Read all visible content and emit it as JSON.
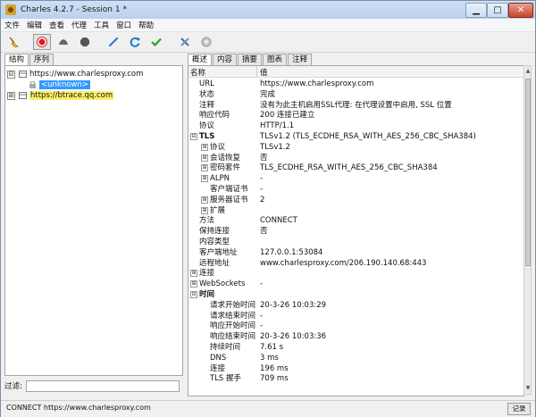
{
  "window": {
    "title": "Charles 4.2.7 - Session 1 *"
  },
  "menu": [
    "文件",
    "编辑",
    "查看",
    "代理",
    "工具",
    "窗口",
    "帮助"
  ],
  "toolbar": [
    "broom-icon",
    "record-icon",
    "throttle-icon",
    "breakpoint-icon",
    "compose-icon",
    "repeat-icon",
    "validate-icon",
    "tools-icon",
    "settings-icon"
  ],
  "left": {
    "tabs": [
      "结构",
      "序列"
    ],
    "tree": [
      {
        "label": "https://www.charlesproxy.com",
        "expander": "⊟",
        "level": 0
      },
      {
        "label": "<unknown>",
        "expander": "",
        "level": 1
      },
      {
        "label": "https://btrace.qq.com",
        "expander": "⊞",
        "level": 0
      }
    ],
    "filter_label": "过滤:",
    "filter_value": ""
  },
  "right": {
    "tabs": [
      "概述",
      "内容",
      "摘要",
      "图表",
      "注释"
    ],
    "header": {
      "name": "名称",
      "value": "值"
    },
    "rows": [
      {
        "name": "URL",
        "value": "https://www.charlesproxy.com",
        "level": 1
      },
      {
        "name": "状态",
        "value": "完成",
        "level": 1
      },
      {
        "name": "注释",
        "value": "没有为此主机启用SSL代理: 在代理设置中启用, SSL 位置",
        "level": 1
      },
      {
        "name": "响应代码",
        "value": "200 连接已建立",
        "level": 1
      },
      {
        "name": "协议",
        "value": "HTTP/1.1",
        "level": 1
      },
      {
        "name": "TLS",
        "value": "TLSv1.2 (TLS_ECDHE_RSA_WITH_AES_256_CBC_SHA384)",
        "level": 0,
        "expander": "⊟",
        "bold": true
      },
      {
        "name": "协议",
        "value": "TLSv1.2",
        "level": 2,
        "expander": "⊞"
      },
      {
        "name": "会话恢复",
        "value": "否",
        "level": 2,
        "expander": "⊞"
      },
      {
        "name": "密码套件",
        "value": "TLS_ECDHE_RSA_WITH_AES_256_CBC_SHA384",
        "level": 2,
        "expander": "⊞"
      },
      {
        "name": "ALPN",
        "value": "-",
        "level": 2,
        "expander": "⊞"
      },
      {
        "name": "客户端证书",
        "value": "-",
        "level": 2
      },
      {
        "name": "服务器证书",
        "value": "2",
        "level": 2,
        "expander": "⊞"
      },
      {
        "name": "扩展",
        "value": "",
        "level": 2,
        "expander": "⊞"
      },
      {
        "name": "方法",
        "value": "CONNECT",
        "level": 1
      },
      {
        "name": "保持连接",
        "value": "否",
        "level": 1
      },
      {
        "name": "内容类型",
        "value": "",
        "level": 1
      },
      {
        "name": "客户端地址",
        "value": "127.0.0.1:53084",
        "level": 1
      },
      {
        "name": "远程地址",
        "value": "www.charlesproxy.com/206.190.140.68:443",
        "level": 1
      },
      {
        "name": "连接",
        "value": "",
        "level": 0,
        "expander": "⊞"
      },
      {
        "name": "WebSockets",
        "value": "-",
        "level": 0,
        "expander": "⊞"
      },
      {
        "name": "时间",
        "value": "",
        "level": 0,
        "expander": "⊟",
        "bold": true
      },
      {
        "name": "请求开始时间",
        "value": "20-3-26 10:03:29",
        "level": 2
      },
      {
        "name": "请求结束时间",
        "value": "-",
        "level": 2
      },
      {
        "name": "响应开始时间",
        "value": "-",
        "level": 2
      },
      {
        "name": "响应结束时间",
        "value": "20-3-26 10:03:36",
        "level": 2
      },
      {
        "name": "持续时间",
        "value": "7.61 s",
        "level": 2
      },
      {
        "name": "DNS",
        "value": "3 ms",
        "level": 2
      },
      {
        "name": "连接",
        "value": "196 ms",
        "level": 2
      },
      {
        "name": "TLS 握手",
        "value": "709 ms",
        "level": 2
      }
    ]
  },
  "status": {
    "text": "CONNECT https://www.charlesproxy.com",
    "button": "记录"
  }
}
